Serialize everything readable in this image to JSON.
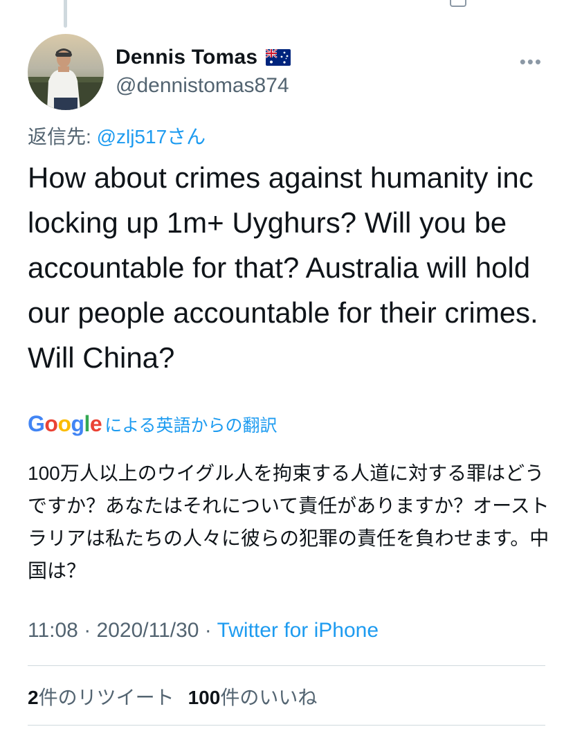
{
  "tweet": {
    "author": {
      "display_name": "Dennis Tomas",
      "handle": "@dennistomas874",
      "flag_icon": "australia-flag-icon"
    },
    "more_icon": "more-horizontal-icon",
    "reply_prefix": "返信先: ",
    "reply_mention": "@zlj517さん",
    "text": "How about crimes against humanity inc locking up 1m+ Uyghurs? Will you be accountable for that? Australia will hold our people accountable for their crimes. Will China?",
    "translation": {
      "logo_text": "Google",
      "logo_colors": [
        "#4285F4",
        "#EA4335",
        "#FBBC05",
        "#4285F4",
        "#34A853",
        "#EA4335"
      ],
      "label": "による英語からの翻訳",
      "text": "100万人以上のウイグル人を拘束する人道に対する罪はどうですか？あなたはそれについて責任がありますか？オーストラリアは私たちの人々に彼らの犯罪の責任を負わせます。中国は？"
    },
    "time": "11:08",
    "date": "2020/11/30",
    "separator": " · ",
    "source": "Twitter for iPhone",
    "stats": {
      "retweets_count": "2",
      "retweets_label": "件のリツイート",
      "likes_count": "100",
      "likes_label": "件のいいね"
    }
  },
  "colors": {
    "accent": "#1d9bf0",
    "secondary_text": "#536471",
    "divider": "#cfd9de"
  }
}
